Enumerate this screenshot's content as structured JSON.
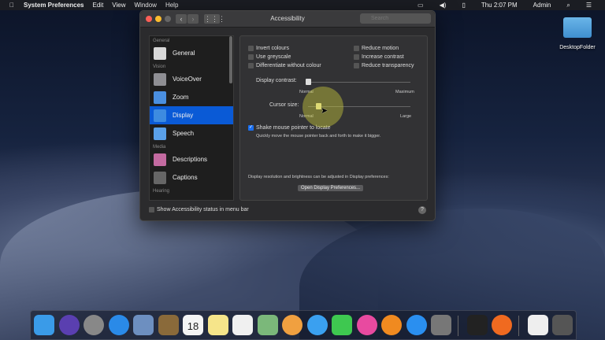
{
  "menubar": {
    "app": "System Preferences",
    "items": [
      "Edit",
      "View",
      "Window",
      "Help"
    ],
    "clock": "Thu 2:07 PM",
    "user": "Admin"
  },
  "window": {
    "title": "Accessibility",
    "search_placeholder": "Search"
  },
  "sidebar": {
    "sections": [
      {
        "header": "General",
        "items": [
          {
            "label": "General",
            "color": "#d8d8d8"
          }
        ]
      },
      {
        "header": "Vision",
        "items": [
          {
            "label": "VoiceOver",
            "color": "#8e8e93"
          },
          {
            "label": "Zoom",
            "color": "#4a8fe0"
          },
          {
            "label": "Display",
            "color": "#3d8be0",
            "selected": true
          },
          {
            "label": "Speech",
            "color": "#5aa0e8"
          }
        ]
      },
      {
        "header": "Media",
        "items": [
          {
            "label": "Descriptions",
            "color": "#c36aa0"
          },
          {
            "label": "Captions",
            "color": "#666"
          }
        ]
      },
      {
        "header": "Hearing",
        "items": []
      }
    ]
  },
  "display": {
    "checkboxes_left": [
      {
        "label": "Invert colours",
        "checked": false
      },
      {
        "label": "Use greyscale",
        "checked": false
      },
      {
        "label": "Differentiate without colour",
        "checked": false
      }
    ],
    "checkboxes_right": [
      {
        "label": "Reduce motion",
        "checked": false
      },
      {
        "label": "Increase contrast",
        "checked": false
      },
      {
        "label": "Reduce transparency",
        "checked": false
      }
    ],
    "contrast": {
      "label": "Display contrast:",
      "min": "Normal",
      "max": "Maximum",
      "value": 0
    },
    "cursor": {
      "label": "Cursor size:",
      "min": "Normal",
      "max": "Large",
      "value": 0.1
    },
    "shake": {
      "label": "Shake mouse pointer to locate",
      "checked": true,
      "description": "Quickly move the mouse pointer back and forth to make it bigger."
    },
    "note": "Display resolution and brightness can be adjusted in Display preferences:",
    "open_button": "Open Display Preferences..."
  },
  "footer": {
    "status_label": "Show Accessibility status in menu bar",
    "status_checked": false,
    "help": "?"
  },
  "desktop": {
    "folder": "DesktopFolder"
  },
  "dock": [
    {
      "name": "finder",
      "color": "#3a9be8"
    },
    {
      "name": "siri",
      "color": "#5a3fb0"
    },
    {
      "name": "launchpad",
      "color": "#888"
    },
    {
      "name": "safari",
      "color": "#2a8ae8"
    },
    {
      "name": "preview",
      "color": "#6d8fc0"
    },
    {
      "name": "contacts",
      "color": "#8a6a3a"
    },
    {
      "name": "calendar",
      "color": "#f4f4f4"
    },
    {
      "name": "notes",
      "color": "#f6e58a"
    },
    {
      "name": "reminders",
      "color": "#f0f0f0"
    },
    {
      "name": "maps",
      "color": "#7bb87a"
    },
    {
      "name": "photos",
      "color": "#f0a040"
    },
    {
      "name": "messages",
      "color": "#3aa0f0"
    },
    {
      "name": "facetime",
      "color": "#3ec850"
    },
    {
      "name": "itunes",
      "color": "#e84aa0"
    },
    {
      "name": "ibooks",
      "color": "#f08a20"
    },
    {
      "name": "app-store",
      "color": "#2a8ff0"
    },
    {
      "name": "system-preferences",
      "color": "#777"
    },
    {
      "name": "terminal",
      "color": "#222"
    },
    {
      "name": "firefox",
      "color": "#f06a20"
    },
    {
      "name": "document",
      "color": "#eee"
    },
    {
      "name": "trash",
      "color": "#555"
    }
  ],
  "calendar_day": "18"
}
